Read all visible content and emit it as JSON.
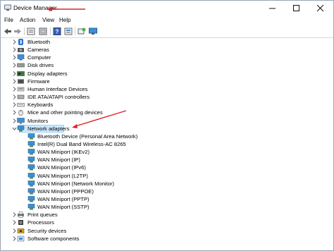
{
  "window": {
    "title": "Device Manager"
  },
  "menu": [
    "File",
    "Action",
    "View",
    "Help"
  ],
  "toolbar": [
    "back-icon",
    "forward-icon",
    "properties-icon",
    "show-hidden-icon",
    "help-icon",
    "update-driver-icon",
    "scan-hardware-icon",
    "monitor-icon"
  ],
  "categories": [
    {
      "label": "Bluetooth",
      "icon": "bluetooth-icon",
      "expanded": false
    },
    {
      "label": "Cameras",
      "icon": "camera-icon",
      "expanded": false
    },
    {
      "label": "Computer",
      "icon": "computer-icon",
      "expanded": false
    },
    {
      "label": "Disk drives",
      "icon": "disk-drive-icon",
      "expanded": false
    },
    {
      "label": "Display adapters",
      "icon": "display-adapter-icon",
      "expanded": false
    },
    {
      "label": "Firmware",
      "icon": "firmware-icon",
      "expanded": false
    },
    {
      "label": "Human Interface Devices",
      "icon": "hid-icon",
      "expanded": false
    },
    {
      "label": "IDE ATA/ATAPI controllers",
      "icon": "ide-controller-icon",
      "expanded": false
    },
    {
      "label": "Keyboards",
      "icon": "keyboard-icon",
      "expanded": false
    },
    {
      "label": "Mice and other pointing devices",
      "icon": "mouse-icon",
      "expanded": false
    },
    {
      "label": "Monitors",
      "icon": "monitor-icon",
      "expanded": false
    },
    {
      "label": "Network adapters",
      "icon": "network-adapter-icon",
      "expanded": true,
      "selected": true,
      "children": [
        "Bluetooth Device (Personal Area Network)",
        "Intel(R) Dual Band Wireless-AC 8265",
        "WAN Miniport (IKEv2)",
        "WAN Miniport (IP)",
        "WAN Miniport (IPv6)",
        "WAN Miniport (L2TP)",
        "WAN Miniport (Network Monitor)",
        "WAN Miniport (PPPOE)",
        "WAN Miniport (PPTP)",
        "WAN Miniport (SSTP)"
      ]
    },
    {
      "label": "Print queues",
      "icon": "printer-icon",
      "expanded": false
    },
    {
      "label": "Processors",
      "icon": "processor-icon",
      "expanded": false
    },
    {
      "label": "Security devices",
      "icon": "security-device-icon",
      "expanded": false
    },
    {
      "label": "Software components",
      "icon": "software-component-icon",
      "expanded": false
    }
  ],
  "colors": {
    "selection": "#cce8ff",
    "annotation_arrow": "#e0202a",
    "icon_blue": "#3c8fd6"
  }
}
